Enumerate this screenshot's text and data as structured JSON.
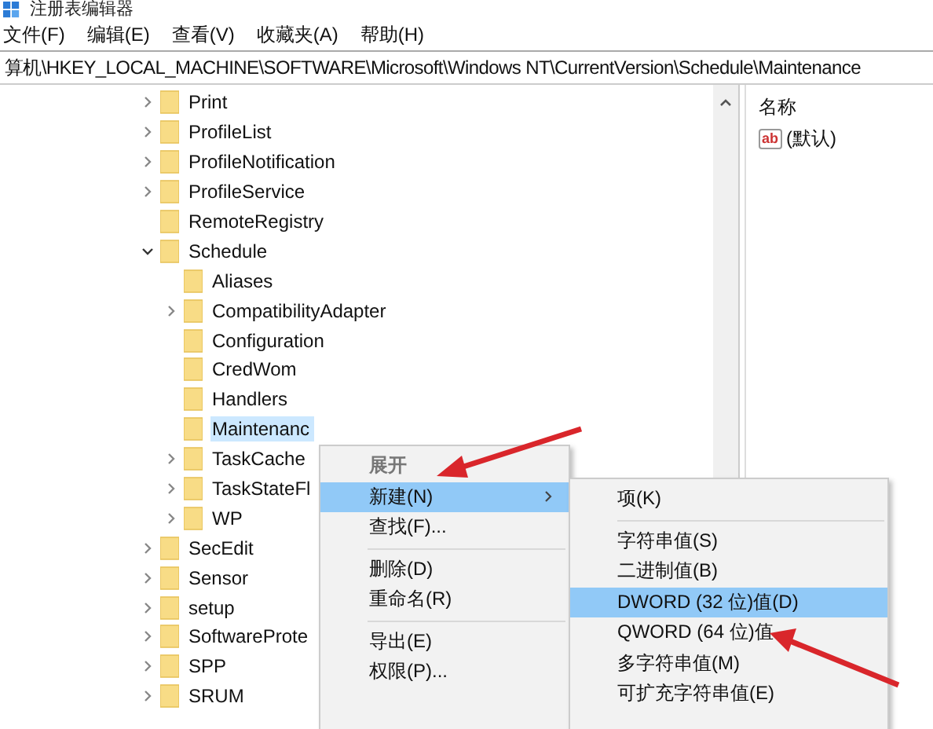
{
  "window": {
    "title": "注册表编辑器"
  },
  "menu": [
    "文件(F)",
    "编辑(E)",
    "查看(V)",
    "收藏夹(A)",
    "帮助(H)"
  ],
  "address": "算机\\HKEY_LOCAL_MACHINE\\SOFTWARE\\Microsoft\\Windows NT\\CurrentVersion\\Schedule\\Maintenance",
  "tree": [
    {
      "label": "Print",
      "kind": "branch",
      "expanded": false,
      "selected": false
    },
    {
      "label": "ProfileList",
      "kind": "branch",
      "expanded": false,
      "selected": false
    },
    {
      "label": "ProfileNotification",
      "kind": "branch",
      "expanded": false,
      "selected": false
    },
    {
      "label": "ProfileService",
      "kind": "branch",
      "expanded": false,
      "selected": false
    },
    {
      "label": "RemoteRegistry",
      "kind": "leaf",
      "selected": false
    },
    {
      "label": "Schedule",
      "kind": "branch",
      "expanded": true,
      "selected": false,
      "children": [
        {
          "label": "Aliases",
          "kind": "leaf",
          "selected": false
        },
        {
          "label": "CompatibilityAdapter",
          "kind": "branch",
          "expanded": false,
          "selected": false
        },
        {
          "label": "Configuration",
          "kind": "leaf",
          "selected": false
        },
        {
          "label": "CredWom",
          "kind": "leaf",
          "selected": false
        },
        {
          "label": "Handlers",
          "kind": "leaf",
          "selected": false
        },
        {
          "label": "Maintenanc",
          "kind": "leaf",
          "selected": true
        },
        {
          "label": "TaskCache",
          "kind": "branch",
          "expanded": false,
          "selected": false
        },
        {
          "label": "TaskStateFl",
          "kind": "branch",
          "expanded": false,
          "selected": false
        },
        {
          "label": "WP",
          "kind": "branch",
          "expanded": false,
          "selected": false
        }
      ]
    },
    {
      "label": "SecEdit",
      "kind": "branch",
      "expanded": false,
      "selected": false
    },
    {
      "label": "Sensor",
      "kind": "branch",
      "expanded": false,
      "selected": false
    },
    {
      "label": "setup",
      "kind": "branch",
      "expanded": false,
      "selected": false
    },
    {
      "label": "SoftwareProte",
      "kind": "branch",
      "expanded": false,
      "selected": false
    },
    {
      "label": "SPP",
      "kind": "branch",
      "expanded": false,
      "selected": false
    },
    {
      "label": "SRUM",
      "kind": "branch",
      "expanded": false,
      "selected": false
    }
  ],
  "values_pane": {
    "column_header": "名称",
    "rows": [
      {
        "type_icon": "ab",
        "name": "(默认)"
      }
    ]
  },
  "context_menu": [
    {
      "kind": "item",
      "label": "展开",
      "disabled": true,
      "selected": false,
      "submenu": false
    },
    {
      "kind": "item",
      "label": "新建(N)",
      "disabled": false,
      "selected": true,
      "submenu": true
    },
    {
      "kind": "item",
      "label": "查找(F)...",
      "disabled": false,
      "selected": false,
      "submenu": false
    },
    {
      "kind": "separator"
    },
    {
      "kind": "item",
      "label": "删除(D)",
      "disabled": false,
      "selected": false,
      "submenu": false
    },
    {
      "kind": "item",
      "label": "重命名(R)",
      "disabled": false,
      "selected": false,
      "submenu": false
    },
    {
      "kind": "separator"
    },
    {
      "kind": "item",
      "label": "导出(E)",
      "disabled": false,
      "selected": false,
      "submenu": false
    },
    {
      "kind": "item",
      "label": "权限(P)...",
      "disabled": false,
      "selected": false,
      "submenu": false
    }
  ],
  "submenu": [
    {
      "kind": "item",
      "label": "项(K)",
      "selected": false
    },
    {
      "kind": "separator"
    },
    {
      "kind": "item",
      "label": "字符串值(S)",
      "selected": false
    },
    {
      "kind": "item",
      "label": "二进制值(B)",
      "selected": false
    },
    {
      "kind": "item",
      "label": "DWORD (32 位)值(D)",
      "selected": true
    },
    {
      "kind": "item",
      "label": "QWORD (64 位)值",
      "selected": false
    },
    {
      "kind": "item",
      "label": "多字符串值(M)",
      "selected": false
    },
    {
      "kind": "item",
      "label": "可扩充字符串值(E)",
      "selected": false
    }
  ]
}
